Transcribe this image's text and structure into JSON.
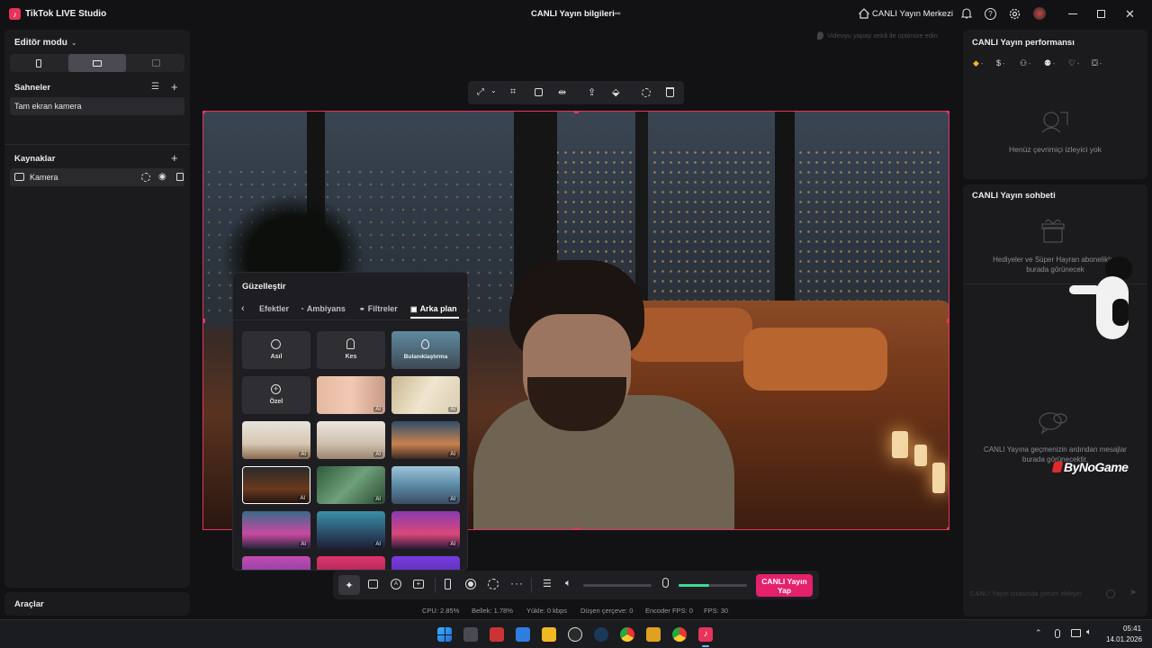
{
  "app": {
    "title": "TikTok LIVE Studio",
    "stream_info": "CANLI Yayın bilgileri",
    "center": "CANLI Yayın Merkezi"
  },
  "left": {
    "editor_mode": "Editör modu",
    "scenes_title": "Sahneler",
    "scene_item": "Tam ekran kamera",
    "sources_title": "Kaynaklar",
    "source_item": "Kamera",
    "tools": "Araçlar"
  },
  "preview": {
    "ai_hint": "Videoyu yapay zekâ ile optimize edin"
  },
  "beautify": {
    "title": "Güzelleştir",
    "tabs": [
      "Efektler",
      "Ambiyans",
      "Filtreler",
      "Arka plan"
    ],
    "options": [
      "Asıl",
      "Kes",
      "Bulanıklaştırma",
      "Özel"
    ],
    "ai_badge": "AI"
  },
  "right": {
    "performance_title": "CANLI Yayın performansı",
    "no_viewers": "Henüz çevrimiçi izleyici yok",
    "chat_title": "CANLI Yayın sohbeti",
    "gifts_note": "Hediyeler ve Süper Hayran abonelikleri burada görünecek",
    "chat_note": "CANLI Yayına geçmenizin ardından mesajlar burada görünecektir.",
    "watermark": "ByNoGame",
    "chat_placeholder": "CANLI Yayın sırasında yorum ekleyin"
  },
  "controls": {
    "go_live_line1": "CANLI Yayın",
    "go_live_line2": "Yap",
    "mic_level": 0.45
  },
  "status": {
    "cpu": "CPU: 2.85%",
    "memory": "Bellek: 1.78%",
    "upload": "Yükle: 0 kbps",
    "dropped": "Düşen çerçeve: 0",
    "encoder_fps": "Encoder FPS: 0",
    "fps": "FPS: 30"
  },
  "taskbar": {
    "time": "05:41",
    "date": "14.01.2026"
  },
  "colors": {
    "accent": "#e8335a",
    "live_button": "#e5216b",
    "mic": "#3ddc97"
  }
}
